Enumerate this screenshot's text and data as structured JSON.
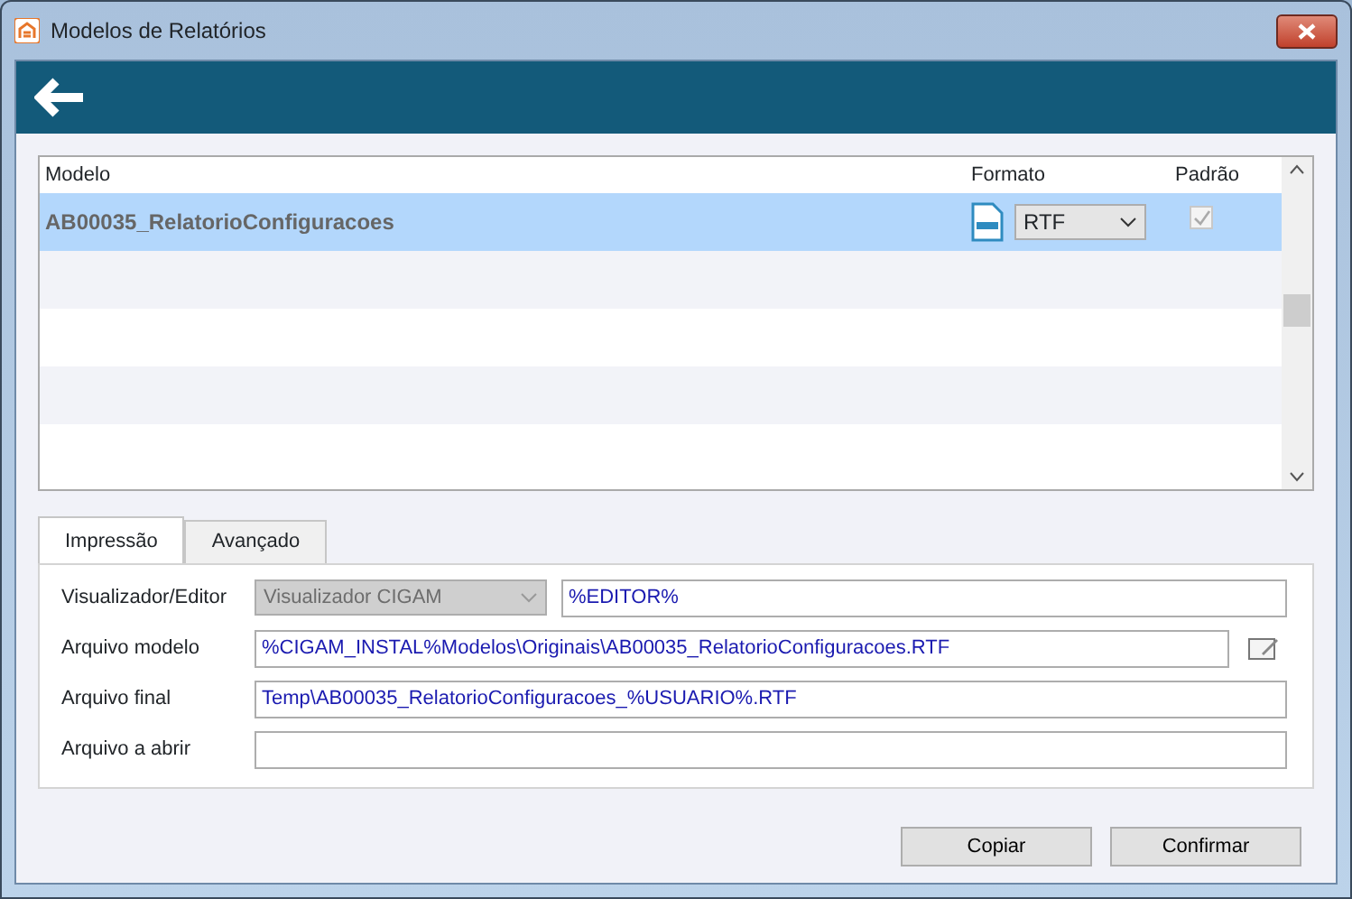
{
  "window": {
    "title": "Modelos de Relatórios"
  },
  "grid": {
    "columns": [
      "Modelo",
      "Formato",
      "Padrão"
    ],
    "rows": [
      {
        "modelo": "AB00035_RelatorioConfiguracoes",
        "formato": "RTF",
        "padrao": true,
        "selected": true
      }
    ]
  },
  "tabs": [
    {
      "label": "Impressão",
      "selected": true
    },
    {
      "label": "Avançado",
      "selected": false
    }
  ],
  "fields": [
    {
      "label": "Visualizador/Editor",
      "kind": "combo-text",
      "combo": "Visualizador CIGAM",
      "combo_disabled": true,
      "value": "%EDITOR%"
    },
    {
      "label": "Arquivo modelo",
      "kind": "text-edit",
      "value": "%CIGAM_INSTAL%Modelos\\Originais\\AB00035_RelatorioConfiguracoes.RTF"
    },
    {
      "label": "Arquivo final",
      "kind": "text",
      "value": "Temp\\AB00035_RelatorioConfiguracoes_%USUARIO%.RTF"
    },
    {
      "label": "Arquivo a abrir",
      "kind": "text"
    }
  ],
  "buttons": [
    "Copiar",
    "Confirmar"
  ]
}
